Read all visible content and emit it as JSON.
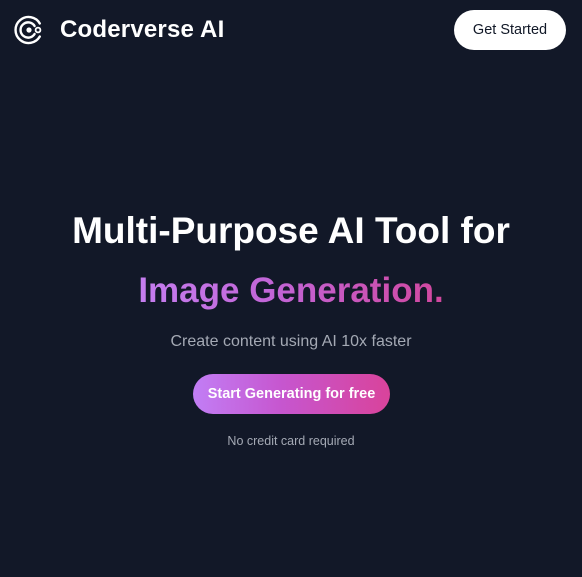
{
  "nav": {
    "logo_icon": "coderverse-logo-icon",
    "brand_name": "Coderverse AI",
    "cta_label": "Get Started"
  },
  "hero": {
    "title": "Multi-Purpose AI Tool for",
    "highlight": "Image Generation.",
    "subtitle": "Create content using AI 10x faster",
    "cta_label": "Start Generating for free",
    "note": "No credit card required"
  },
  "colors": {
    "background": "#121828",
    "text_primary": "#ffffff",
    "text_muted": "#a4a9b4",
    "gradient_start": "#c27ef5",
    "gradient_mid": "#c656cf",
    "gradient_end": "#d9439b",
    "button_light_bg": "#ffffff",
    "button_light_text": "#111827"
  }
}
